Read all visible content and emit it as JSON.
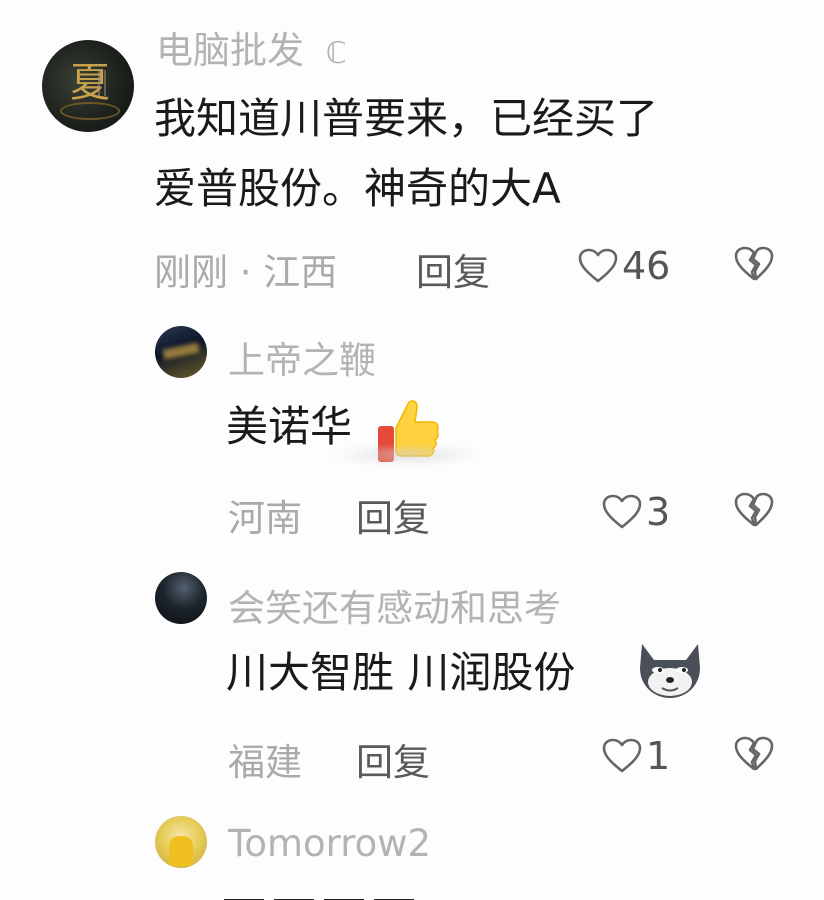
{
  "comments": [
    {
      "username": "电脑批发",
      "username_badge": "ℂ",
      "content_lines": [
        "我知道川普要来，已经买了",
        "爱普股份。神奇的大A"
      ],
      "meta": "刚刚 · 江西",
      "reply": "回复",
      "likes": "46"
    },
    {
      "username": "上帝之鞭",
      "content": "美诺华",
      "emoji": "thumbs-up",
      "meta": "河南",
      "reply": "回复",
      "likes": "3"
    },
    {
      "username": "会笑还有感动和思考",
      "content": "川大智胜 川润股份",
      "emoji": "doge-wolf",
      "meta": "福建",
      "reply": "回复",
      "likes": "1"
    },
    {
      "username": "Tomorrow2"
    }
  ],
  "icons": {
    "like": "heart-outline-icon",
    "dislike": "broken-heart-icon"
  },
  "colors": {
    "text": "#1a1a1a",
    "muted": "#aaaaaa",
    "icon": "#666666"
  }
}
